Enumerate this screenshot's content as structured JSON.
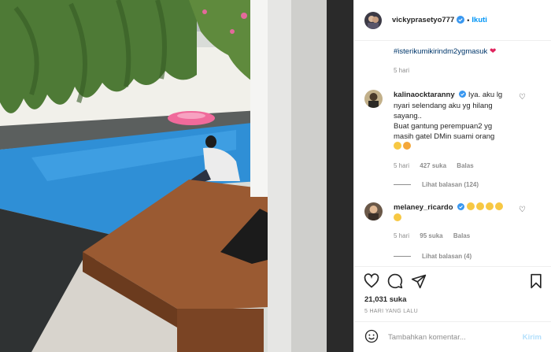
{
  "post": {
    "username": "vickyprasetyo777",
    "separator": "•",
    "follow_label": "Ikuti",
    "photo_alt": "photo"
  },
  "caption": {
    "hashtag": "#isterikumikirindm2ygmasuk",
    "time": "5 hari"
  },
  "comments": [
    {
      "username": "kalinaocktaranny",
      "text_line1": "Iya. aku lg",
      "text_line2": "nyari selendang aku yg hilang",
      "text_line3": "sayang..",
      "text_line4": "Buat gantung perempuan2 yg",
      "text_line5": "masih gatel DMin suami orang",
      "time": "5 hari",
      "likes": "427 suka",
      "reply": "Balas",
      "view_replies": "Lihat balasan (124)"
    },
    {
      "username": "melaney_ricardo",
      "time": "5 hari",
      "likes": "95 suka",
      "reply": "Balas",
      "view_replies": "Lihat balasan (4)"
    }
  ],
  "footer": {
    "like_count": "21,031 suka",
    "posted_time": "5 HARI YANG LALU",
    "comment_placeholder": "Tambahkan komentar...",
    "post_label": "Kirim"
  },
  "colors": {
    "accent": "#0095f6",
    "verified": "#3897f0",
    "muted": "#8e8e8e",
    "post_disabled": "#b2dffc"
  }
}
